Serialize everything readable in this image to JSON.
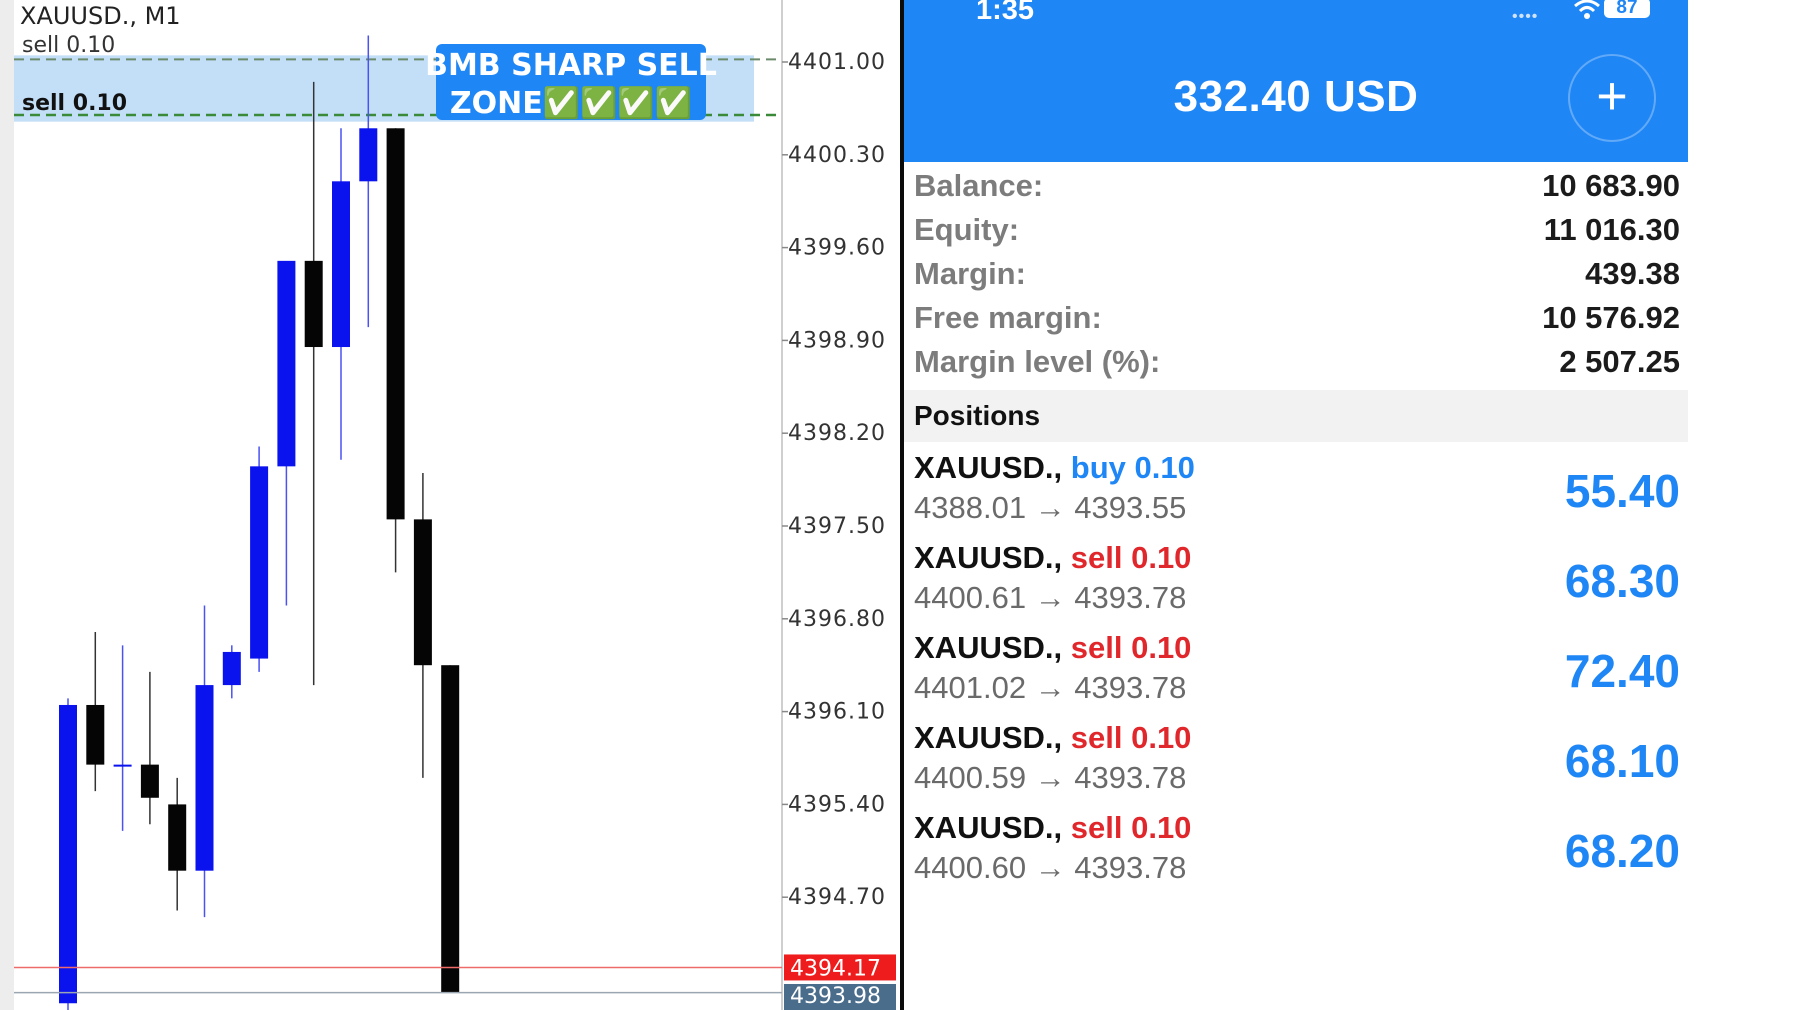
{
  "chart": {
    "symbol_label": "XAUUSD., M1",
    "order_line_labels": [
      "sell 0.10",
      "sell 0.10"
    ],
    "zone_banner": {
      "line1": "BMB SHARP SELL",
      "line2": "ZONE✅✅✅✅"
    },
    "price_ticks": [
      "4401.00",
      "4400.30",
      "4399.60",
      "4398.90",
      "4398.20",
      "4397.50",
      "4396.80",
      "4396.10",
      "4395.40",
      "4394.70"
    ],
    "ask_price": "4394.17",
    "bid_price": "4393.98",
    "colors": {
      "bull": "#0a12ee",
      "bear": "#050505",
      "ask_tag": "#ee1c1c",
      "bid_tag": "#4a6d8c",
      "zone": "#bcdcf7",
      "banner": "#1f86f5"
    }
  },
  "chart_data": {
    "type": "candlestick",
    "y_ticks": [
      4401.0,
      4400.3,
      4399.6,
      4398.9,
      4398.2,
      4397.5,
      4396.8,
      4396.1,
      4395.4,
      4394.7
    ],
    "ask": 4394.17,
    "bid": 4393.98,
    "sell_zone": [
      4400.55,
      4401.05
    ],
    "order_levels": [
      4401.02,
      4400.6
    ],
    "candles": [
      {
        "o": 4393.9,
        "h": 4396.2,
        "l": 4393.5,
        "c": 4396.15
      },
      {
        "o": 4396.15,
        "h": 4396.7,
        "l": 4395.5,
        "c": 4395.7
      },
      {
        "o": 4395.7,
        "h": 4396.6,
        "l": 4395.2,
        "c": 4395.7
      },
      {
        "o": 4395.7,
        "h": 4396.4,
        "l": 4395.25,
        "c": 4395.45
      },
      {
        "o": 4395.4,
        "h": 4395.6,
        "l": 4394.6,
        "c": 4394.9
      },
      {
        "o": 4394.9,
        "h": 4396.9,
        "l": 4394.55,
        "c": 4396.3
      },
      {
        "o": 4396.3,
        "h": 4396.6,
        "l": 4396.2,
        "c": 4396.55
      },
      {
        "o": 4396.5,
        "h": 4398.1,
        "l": 4396.4,
        "c": 4397.95
      },
      {
        "o": 4397.95,
        "h": 4399.1,
        "l": 4396.9,
        "c": 4399.5
      },
      {
        "o": 4399.5,
        "h": 4400.85,
        "l": 4396.3,
        "c": 4398.85
      },
      {
        "o": 4398.85,
        "h": 4400.5,
        "l": 4398.0,
        "c": 4400.1
      },
      {
        "o": 4400.1,
        "h": 4401.2,
        "l": 4399.0,
        "c": 4400.5
      },
      {
        "o": 4400.5,
        "h": 4400.5,
        "l": 4397.15,
        "c": 4397.55
      },
      {
        "o": 4397.55,
        "h": 4397.9,
        "l": 4395.6,
        "c": 4396.45
      },
      {
        "o": 4396.45,
        "h": 4396.45,
        "l": 4393.98,
        "c": 4393.98
      }
    ]
  },
  "status_bar": {
    "time": "1:35",
    "battery": "87"
  },
  "account": {
    "balance_title": "332.40 USD",
    "add_label": "+",
    "rows": [
      {
        "label": "Balance:",
        "value": "10 683.90"
      },
      {
        "label": "Equity:",
        "value": "11 016.30"
      },
      {
        "label": "Margin:",
        "value": "439.38"
      },
      {
        "label": "Free margin:",
        "value": "10 576.92"
      },
      {
        "label": "Margin level (%):",
        "value": "2 507.25"
      }
    ]
  },
  "positions": {
    "title": "Positions",
    "items": [
      {
        "symbol": "XAUUSD.,",
        "type": "buy 0.10",
        "side": "buy",
        "prices": "4388.01 → 4393.55",
        "profit": "55.40"
      },
      {
        "symbol": "XAUUSD.,",
        "type": "sell 0.10",
        "side": "sell",
        "prices": "4400.61 → 4393.78",
        "profit": "68.30"
      },
      {
        "symbol": "XAUUSD.,",
        "type": "sell 0.10",
        "side": "sell",
        "prices": "4401.02 → 4393.78",
        "profit": "72.40"
      },
      {
        "symbol": "XAUUSD.,",
        "type": "sell 0.10",
        "side": "sell",
        "prices": "4400.59 → 4393.78",
        "profit": "68.10"
      },
      {
        "symbol": "XAUUSD.,",
        "type": "sell 0.10",
        "side": "sell",
        "prices": "4400.60 → 4393.78",
        "profit": "68.20"
      }
    ]
  }
}
